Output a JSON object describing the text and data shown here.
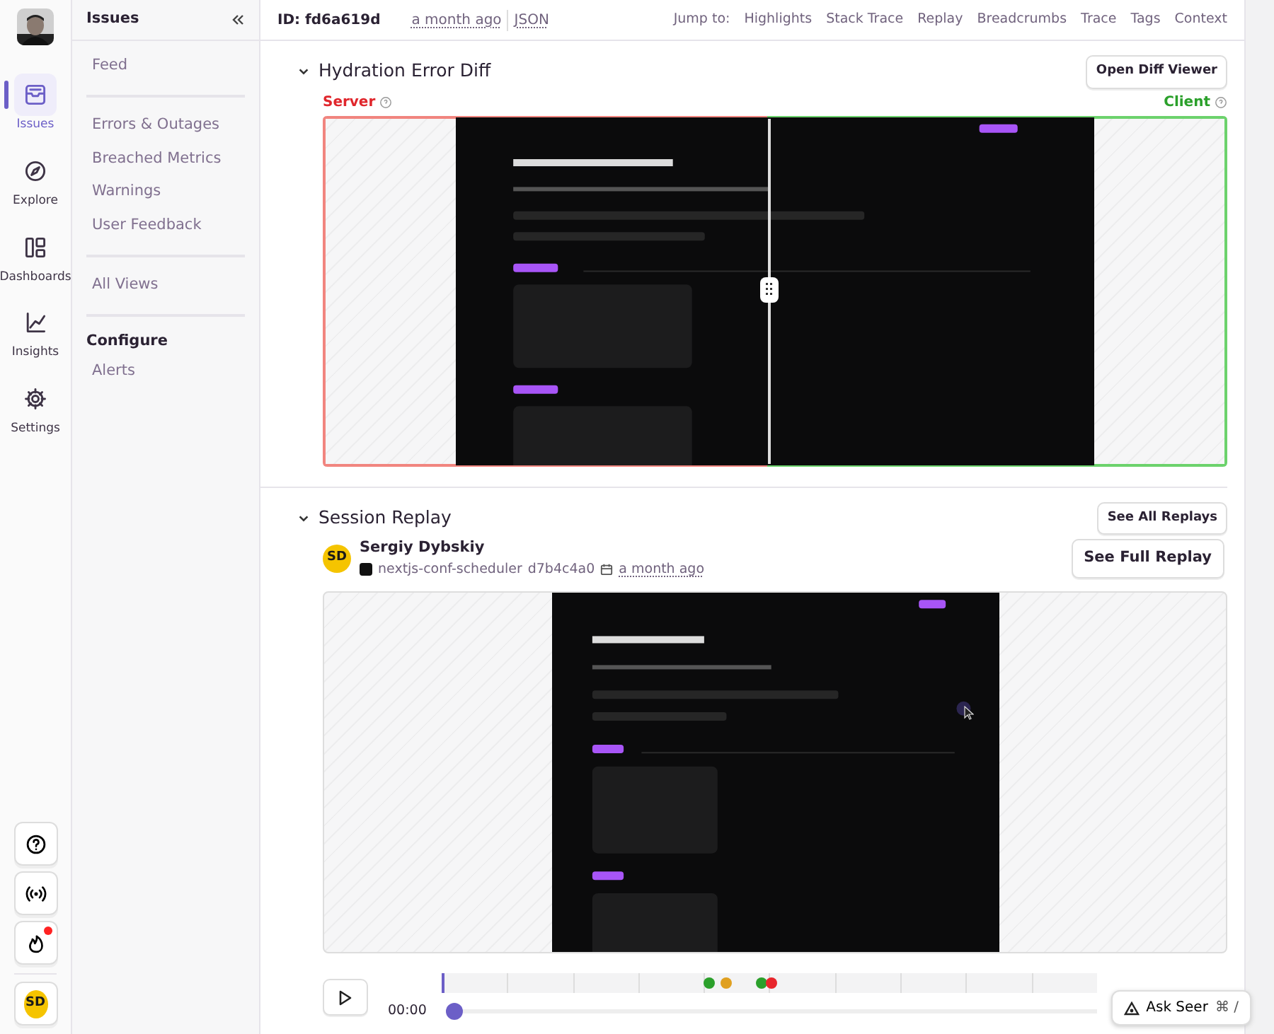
{
  "nav_rail": {
    "items": [
      {
        "label": "Issues",
        "selected": true
      },
      {
        "label": "Explore",
        "selected": false
      },
      {
        "label": "Dashboards",
        "selected": false
      },
      {
        "label": "Insights",
        "selected": false
      },
      {
        "label": "Settings",
        "selected": false
      }
    ],
    "bottom_buttons": [
      {
        "alert": false
      },
      {
        "alert": false
      },
      {
        "alert": true
      }
    ],
    "user_initials": "SD"
  },
  "sidebar": {
    "title": "Issues",
    "groups": [
      {
        "items": [
          "Feed"
        ]
      },
      {
        "items": [
          "Errors & Outages",
          "Breached Metrics",
          "Warnings",
          "User Feedback"
        ]
      },
      {
        "items": [
          "All Views"
        ]
      },
      {
        "heading": "Configure",
        "items": [
          "Alerts"
        ]
      }
    ]
  },
  "header": {
    "id": "ID: fd6a619d",
    "time": "a month ago",
    "json_link": "JSON",
    "jump_label": "Jump to:",
    "jump_links": [
      "Highlights",
      "Stack Trace",
      "Replay",
      "Breadcrumbs",
      "Trace",
      "Tags",
      "Context"
    ]
  },
  "hydration": {
    "title": "Hydration Error Diff",
    "button": "Open Diff Viewer",
    "left_label": "Server",
    "right_label": "Client",
    "level": 0.49
  },
  "replay": {
    "title": "Session Replay",
    "button": "See All Replays",
    "user": {
      "initials": "SD",
      "name": "Sergiy Dybskiy",
      "project": "nextjs-conf-scheduler",
      "release": "d7b4c4a0",
      "time": "a month ago"
    },
    "full_button": "See Full Replay",
    "current_time": "00:00",
    "level": 0,
    "timeline_events": [
      {
        "color": "#2ba02b"
      },
      {
        "color": "#e0a020"
      },
      {
        "color": "#2ba02b"
      },
      {
        "color": "#e8262c"
      }
    ]
  },
  "ask_seer": {
    "label": "Ask Seer",
    "shortcut": "⌘ /"
  }
}
